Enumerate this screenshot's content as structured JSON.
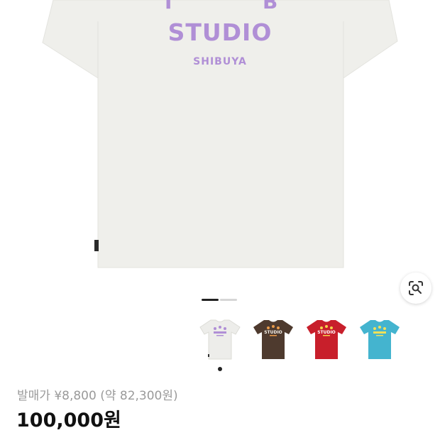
{
  "product_image": {
    "print_arc_letters": [
      "I",
      "B"
    ],
    "print_main": "STUDIO",
    "print_sub": "SHIBUYA",
    "shirt_color": "#efefeb",
    "print_color": "#b08fd6"
  },
  "lens_button": {
    "icon": "image-search-icon"
  },
  "pager": {
    "total": 2,
    "active_index": 0
  },
  "color_variants": [
    {
      "name": "white",
      "shirt": "#ededea",
      "print": "#b08fd6",
      "label": ""
    },
    {
      "name": "brown",
      "shirt": "#4e3a2e",
      "print": "#e89a4a",
      "label": "STUDIO"
    },
    {
      "name": "red",
      "shirt": "#c81f2b",
      "print": "#f4d24a",
      "label": "STUDIO"
    },
    {
      "name": "blue",
      "shirt": "#44b4cf",
      "print": "#f1e15a",
      "label": ""
    }
  ],
  "selected_variant_index": 0,
  "pricing": {
    "retail_label": "발매가 ¥8,800 (약 82,300원)",
    "price": "100,000원"
  }
}
